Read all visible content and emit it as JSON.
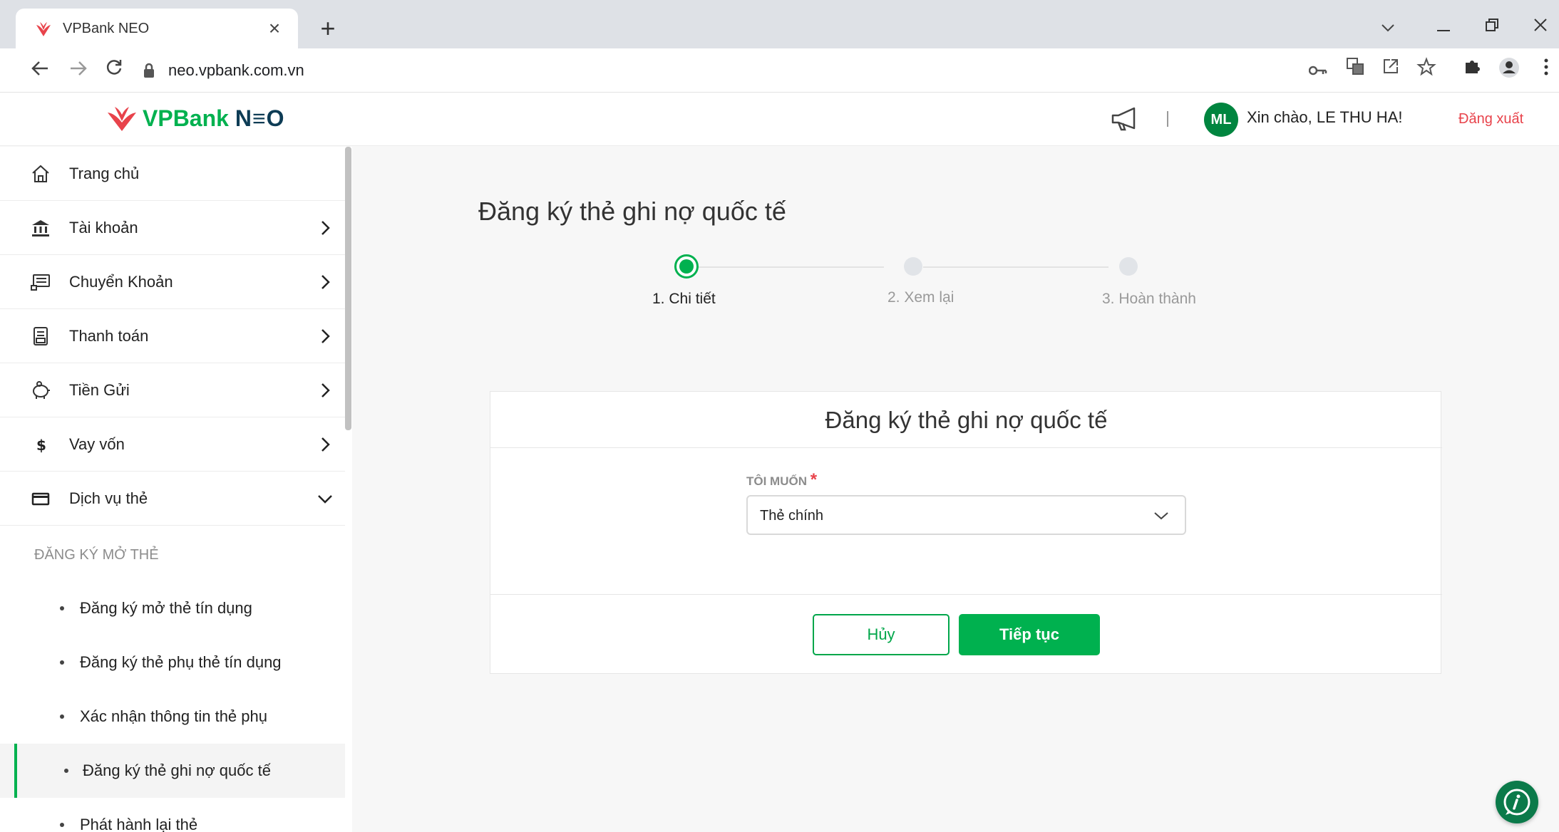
{
  "browser": {
    "tab_title": "VPBank NEO",
    "tab_close": "×",
    "new_tab": "+",
    "url": "neo.vpbank.com.vn"
  },
  "header": {
    "logo_vp": "VPBank",
    "logo_neo": "N≡O",
    "avatar_initials": "ML",
    "greeting": "Xin chào, LE THU HA!",
    "logout": "Đăng xuất"
  },
  "sidebar": {
    "items": [
      {
        "label": "Trang chủ",
        "icon": "home-icon"
      },
      {
        "label": "Tài khoản",
        "icon": "bank-icon"
      },
      {
        "label": "Chuyển Khoản",
        "icon": "transfer-icon"
      },
      {
        "label": "Thanh toán",
        "icon": "bill-icon"
      },
      {
        "label": "Tiền Gửi",
        "icon": "piggy-bank-icon"
      },
      {
        "label": "Vay vốn",
        "icon": "dollar-icon"
      },
      {
        "label": "Dịch vụ thẻ",
        "icon": "card-icon"
      }
    ],
    "section_label": "ĐĂNG KÝ MỞ THẺ",
    "sub_items": [
      {
        "label": "Đăng ký mở thẻ tín dụng"
      },
      {
        "label": "Đăng ký thẻ phụ thẻ tín dụng"
      },
      {
        "label": "Xác nhận thông tin thẻ phụ"
      },
      {
        "label": "Đăng ký thẻ ghi nợ quốc tế"
      },
      {
        "label": "Phát hành lại thẻ"
      }
    ]
  },
  "main": {
    "page_title": "Đăng ký thẻ ghi nợ quốc tế",
    "steps": [
      {
        "label": "1. Chi tiết"
      },
      {
        "label": "2. Xem lại"
      },
      {
        "label": "3. Hoàn thành"
      }
    ],
    "card": {
      "title": "Đăng ký thẻ ghi nợ quốc tế",
      "field_label": "TÔI MUỐN",
      "required_mark": "*",
      "select_value": "Thẻ chính",
      "cancel_label": "Hủy",
      "next_label": "Tiếp tục"
    }
  },
  "colors": {
    "brand_green": "#00b14f",
    "brand_red": "#e8434b",
    "brand_navy": "#0d3c55"
  }
}
